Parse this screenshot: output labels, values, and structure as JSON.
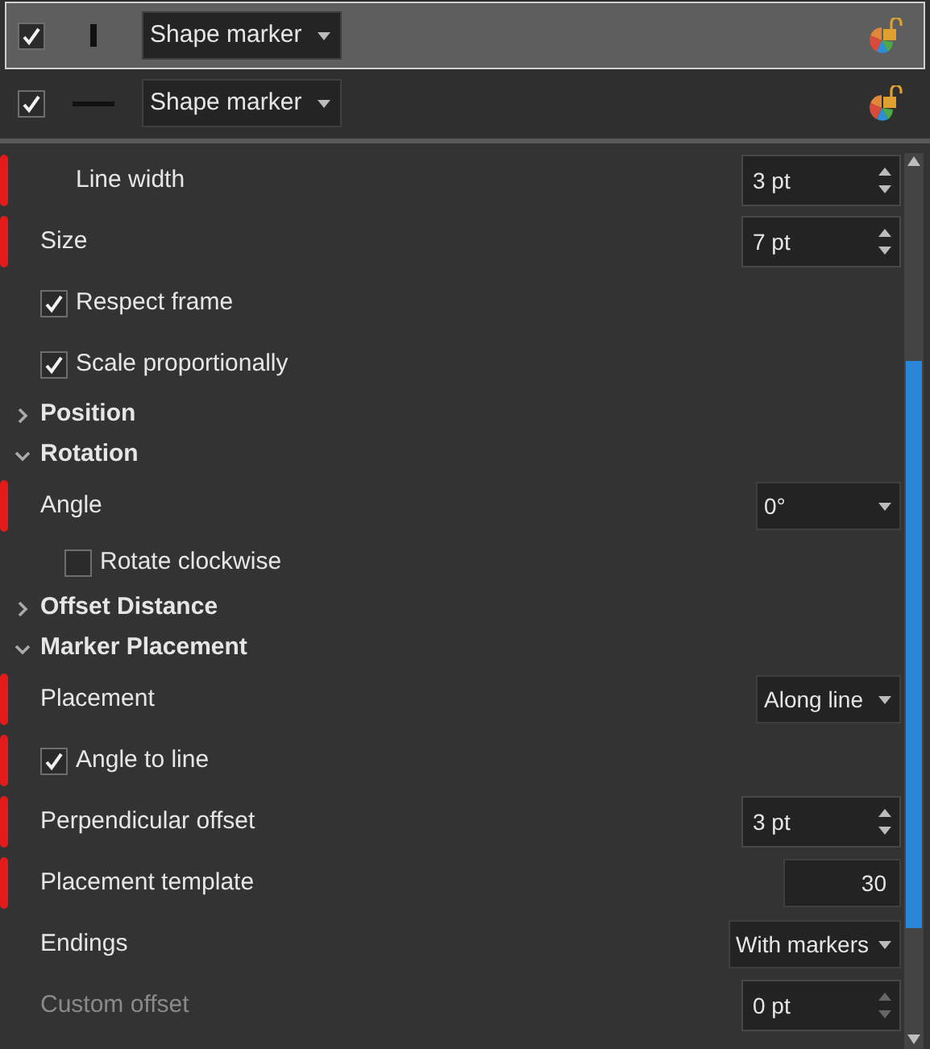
{
  "layers": [
    {
      "checked": true,
      "kind": "vertical",
      "type": "Shape marker",
      "selected": true
    },
    {
      "checked": true,
      "kind": "horizontal",
      "type": "Shape marker",
      "selected": false
    }
  ],
  "properties": [
    {
      "kind": "spin",
      "label": "Line width",
      "value": "3 pt",
      "indented": true,
      "annotated": true
    },
    {
      "kind": "spin",
      "label": "Size",
      "value": "7 pt",
      "annotated": true
    },
    {
      "kind": "check",
      "label": "Respect frame",
      "checked": true
    },
    {
      "kind": "check",
      "label": "Scale proportionally",
      "checked": true
    },
    {
      "kind": "section",
      "label": "Position",
      "expanded": false
    },
    {
      "kind": "section",
      "label": "Rotation",
      "expanded": true
    },
    {
      "kind": "dropdown",
      "label": "Angle",
      "value": "0°",
      "annotated": true,
      "children": [
        {
          "kind": "check",
          "label": "Rotate clockwise",
          "checked": false
        }
      ]
    },
    {
      "kind": "section",
      "label": "Offset Distance",
      "expanded": false
    },
    {
      "kind": "section",
      "label": "Marker Placement",
      "expanded": true
    },
    {
      "kind": "dropdown",
      "label": "Placement",
      "value": "Along line",
      "annotated": true
    },
    {
      "kind": "check",
      "label": "Angle to line",
      "checked": true,
      "annotated": true
    },
    {
      "kind": "spin",
      "label": "Perpendicular offset",
      "value": "3 pt",
      "annotated": true
    },
    {
      "kind": "number",
      "label": "Placement template",
      "value": "30",
      "annotated": true
    },
    {
      "kind": "dropdown",
      "label": "Endings",
      "value": "With markers"
    },
    {
      "kind": "spin",
      "label": "Custom offset",
      "value": "0 pt",
      "disabled": true
    }
  ]
}
